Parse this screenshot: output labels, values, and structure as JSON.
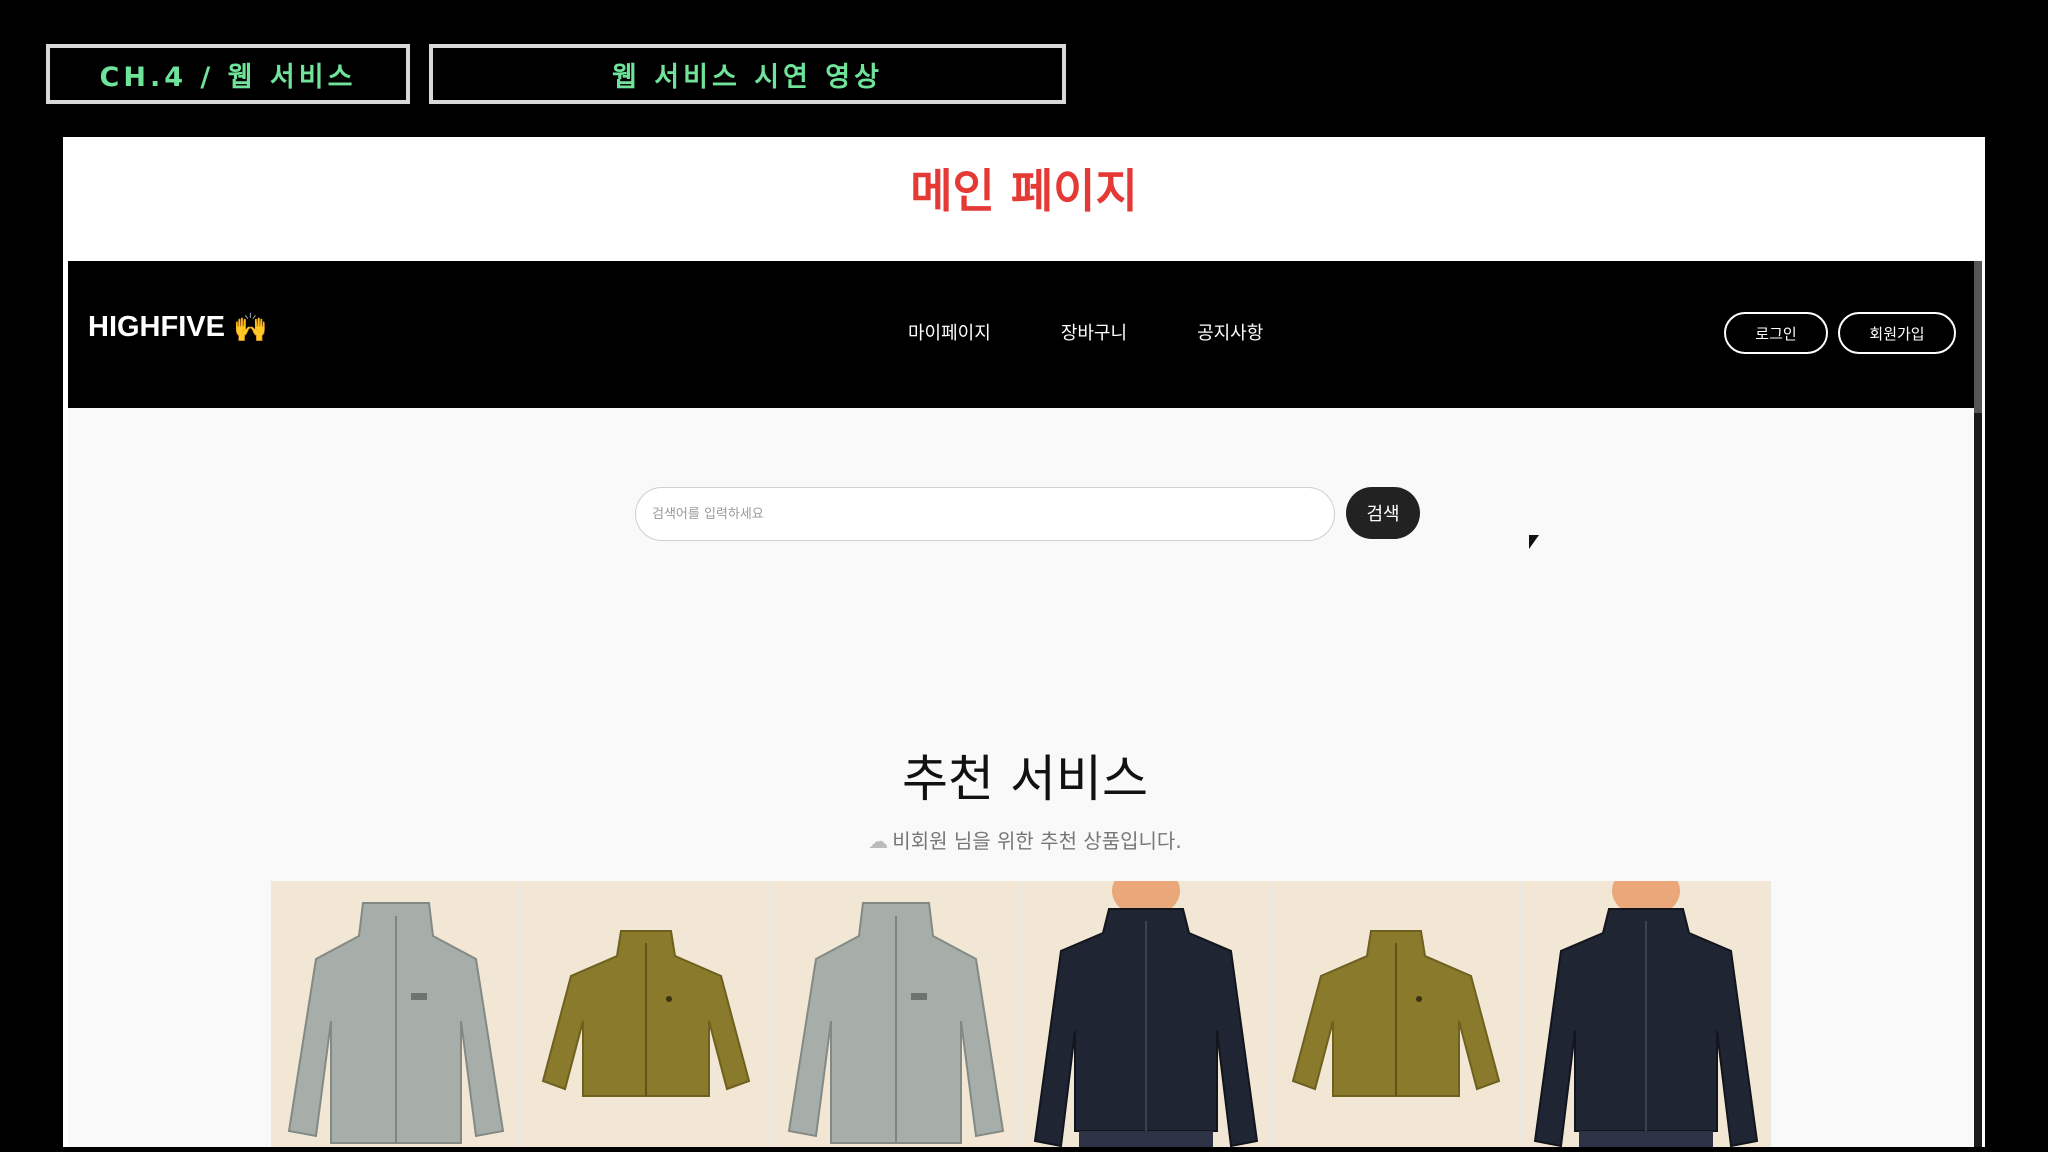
{
  "header_tags": {
    "chapter": "CH.4 / 웹 서비스",
    "section": "웹 서비스 시연 영상"
  },
  "slide_title": "메인 페이지",
  "site": {
    "logo": "HIGHFIVE",
    "logo_icon": "raised-hands-icon",
    "nav": [
      "마이페이지",
      "장바구니",
      "공지사항"
    ],
    "login_label": "로그인",
    "signup_label": "회원가입"
  },
  "search": {
    "placeholder": "검색어를 입력하세요",
    "button_label": "검색"
  },
  "recommend": {
    "title": "추천 서비스",
    "subtitle": "비회원 님을 위한 추천 상품입니다."
  },
  "products": [
    {
      "name": "",
      "image": "gray-fleece-jacket"
    },
    {
      "name": "",
      "image": "olive-bomber-jacket"
    },
    {
      "name": "",
      "image": "gray-fleece-jacket"
    },
    {
      "name": "",
      "image": "navy-fleece-jacket-model"
    },
    {
      "name": "",
      "image": "olive-bomber-jacket"
    },
    {
      "name": "",
      "image": "navy-fleece-jacket-model"
    }
  ],
  "colors": {
    "tag_text": "#6fe39a",
    "slide_title": "#e53935",
    "navbar_bg": "#000000",
    "gray_jacket": "#a7ada8",
    "olive_jacket": "#8a7a2c",
    "navy_jacket": "#1f2532"
  }
}
